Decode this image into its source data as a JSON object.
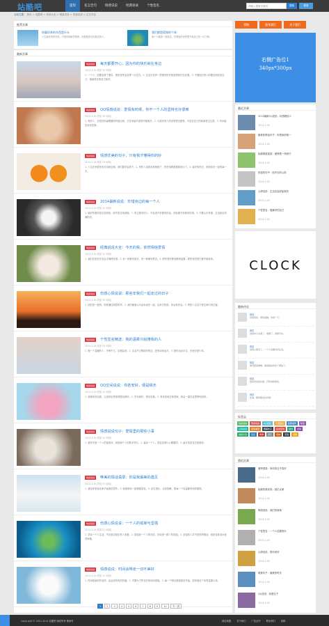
{
  "header": {
    "logo": "站酷吧",
    "nav": [
      "首页",
      "名言佳句",
      "情感说说",
      "经典语录",
      "个性签名"
    ],
    "search_placeholder": "请输入搜索关键词",
    "search_button": "搜索",
    "login_button": "登录"
  },
  "breadcrumb": {
    "home": "当前位置：",
    "path": "首页 > 站酷吧 > 说说大全 > 情感说说 > 伤感说说 > 正文内容"
  },
  "hot": {
    "title": "推荐文章",
    "items": [
      {
        "title": "你最珍贵的东西是什么",
        "desc": "人生最珍贵的东西，不是你拥有的物质，而是陪伴在你身边的人。"
      },
      {
        "title": "我们都是孤独的个体",
        "desc": "每个人都是一座孤岛，在喧嚣的世界里守着自己的一片宁静。"
      }
    ]
  },
  "list": {
    "title": "最新文章",
    "tag_label": "情感说说",
    "articles": [
      {
        "title": "每天都要开心，因为你的快乐就在身边",
        "meta": "2014-3-26  浏览 30  0评论",
        "desc": "1. 一个人，如果没有了爱情，他的世界会变得一片空白。2. 生活中总有一些美好的东西值得我们去珍惜。3. 不要因为别人的眼光而改变自己，做最真实的自己就好。"
      },
      {
        "title": "QQ情感说说：爱情有时候，你不一个人的坚持也许很难",
        "meta": "2014-3-26  浏览 28  0评论",
        "desc": "1. 有的人，总是在你最需要的时候出现，又在你最不舍的时候离开。2. 与其在别人的世界里当配角，不如在自己的故事里当主角。3. 时间会告诉你答案。"
      },
      {
        "title": "情感优美的句子，只有我才懂得你的好",
        "meta": "2014-3-26  浏览 25  0评论",
        "desc": "1. 人生总有很多的无奈和遗憾，我们要学会放下。2. 有些人走着走着就散了，有些事看着看着就淡了。3. 最好的时光，是和你在一起的每一天。"
      },
      {
        "title": "2014最新说说：珍惜身边的每一个人",
        "meta": "2014-3-26  浏览 22  0评论",
        "desc": "1. 最好的爱情是互相成就，而不是互相消耗。2. 真正爱你的人，不会说许多爱你的话，却会做许多爱你的事。3. 只要心中有爱，生活就会充满阳光。"
      },
      {
        "title": "经典说说大全：今天的我，依然相信爱情",
        "meta": "2014-3-26  浏览 20  0评论",
        "desc": "1. 我们总是在失去后才懂得珍惜。2. 有一种爱叫放手，有一种痛叫思念。3. 愿所有的等待都有结果，愿所有的努力都不被辜负。"
      },
      {
        "title": "伤感心情说说：那些年我们一起走过的日子",
        "meta": "2014-3-26  浏览 18  0评论",
        "desc": "1. 回忆是一座桥，却是通往寂寞的牢。2. 我们都曾以为会永远在一起，后来才知道，永远有多远。3. 有些人注定只是生命中的过客。"
      },
      {
        "title": "个性签名精选：我的温柔只给懂我的人",
        "meta": "2014-3-26  浏览 16  0评论",
        "desc": "1. 做一个温暖的人，不卑不亢，清澈善良。2. 生活不止眼前的苟且，还有诗和远方。3. 愿你出走半生，归来仍是少年。"
      },
      {
        "title": "QQ空间说说：你若安好，便是晴天",
        "meta": "2014-3-26  浏览 15  0评论",
        "desc": "1. 感谢你的出现，让我的世界变得更加美好。2. 岁月静好，现世安稳。3. 有你的地方就是家，我会一直在这里等你回来。"
      },
      {
        "title": "情感说说句子：爱情里的那些小事",
        "meta": "2014-3-26  浏览 14  0评论",
        "desc": "1. 爱情不是一个人的独角戏，而是两个人的携手同行。2. 喜欢一个人，是会变得小心翼翼的。3. 最长情的告白是陪伴。"
      },
      {
        "title": "唯美的情话语录：你是我最美的遇见",
        "meta": "2014-3-26  浏览 13  0评论",
        "desc": "1. 遇见你是我这辈子最美的意外。2. 我想和你一起慢慢变老。3. 余生很长，请多指教，愿每一个清晨都有你的微笑。"
      },
      {
        "title": "伤感心情说说：一个人的孤单与坚强",
        "meta": "2014-3-26  浏览 12  0评论",
        "desc": "1. 学会一个人生活，不论身边是否有人宠爱。2. 孤独是一个人的狂欢，狂欢是一群人的孤独。3. 坚强的人并不是没有眼泪，而是含着泪水依然奔跑。"
      },
      {
        "title": "情感说说：时间会带走一切不美好",
        "meta": "2014-3-26  浏览 10  0评论",
        "desc": "1. 时间是最好的良药，会治愈所有的伤痛。2. 不要为了昨天的事情而烦恼。3. 每一个明天都是新的开始，愿你被这个世界温柔以待。"
      }
    ]
  },
  "pager": [
    "1",
    "2",
    "3",
    "4",
    "5",
    "6",
    "7",
    "8",
    "9",
    "10",
    "下一页"
  ],
  "sidebar": {
    "buttons": [
      "投稿",
      "联系我们",
      "关于我们"
    ],
    "button_colors": [
      "#f06b1e",
      "#f06b1e",
      "#f06b1e"
    ],
    "ad": [
      "右侧广告位1",
      "340px*300px"
    ],
    "recent_title": "最近文章",
    "recent": [
      {
        "title": "2014最新QQ说说：珍惜眼前人",
        "date": "2014-3-26"
      },
      {
        "title": "最美的情话句子，你是我的唯一",
        "date": "2014-3-26"
      },
      {
        "title": "经典情感语录：爱情是一场修行",
        "date": "2014-3-26"
      },
      {
        "title": "伤感的句子：回不去的从前",
        "date": "2014-3-26"
      },
      {
        "title": "心情说说：生活总会好起来的",
        "date": "2014-3-26"
      },
      {
        "title": "个性签名：做最好的自己",
        "date": "2014-3-26"
      }
    ],
    "clock_text": "CLOCK",
    "comments_title": "最新评论",
    "comments": [
      {
        "name": "网友",
        "text": "写得真好，很有感触，支持一下！"
      },
      {
        "name": "网友",
        "text": "这些句子太美了，收藏了，谢谢分享。"
      },
      {
        "name": "网友",
        "text": "说到心里去了，一个人也要好好生活。"
      },
      {
        "name": "网友",
        "text": "每天都来看看，越来越喜欢这个网站了。"
      },
      {
        "name": "网友",
        "text": "很喜欢这篇文章，已转发给朋友。"
      },
      {
        "name": "网友",
        "text": "加油，期待更多好内容！"
      }
    ],
    "tags_title": "标签云",
    "tags": [
      "情感说说",
      "伤感说说",
      "QQ说说",
      "个性签名",
      "经典语录",
      "情话",
      "心情说说",
      "爱情语录",
      "唯美句子",
      "名言佳句",
      "励志",
      "友情",
      "说说大全",
      "签名",
      "青春",
      "回忆",
      "孤独",
      "坚强",
      "温暖"
    ],
    "tag_colors": [
      "#5cb85c",
      "#d9534f",
      "#5bc0de",
      "#f0ad4e",
      "#428bca",
      "#9b59b6",
      "#1abc9c",
      "#e67e22",
      "#34495e",
      "#e74c3c",
      "#16a085",
      "#8e44ad",
      "#27ae60",
      "#2980b9",
      "#c0392b",
      "#7f8c8d",
      "#d35400",
      "#2c3e50",
      "#f39c12"
    ],
    "random_title": "随机文章",
    "random": [
      {
        "title": "爱情语录：有你的日子真好",
        "date": "2014-3-26"
      },
      {
        "title": "经典伤感说说：回忆太美",
        "date": "2014-3-26"
      },
      {
        "title": "情感说说：我们的故事",
        "date": "2014-3-26"
      },
      {
        "title": "个性签名：一个人也要快乐",
        "date": "2014-3-26"
      },
      {
        "title": "心情说说：愿你安好",
        "date": "2014-3-26"
      },
      {
        "title": "唯美句子：最美的时光",
        "date": "2014-3-26"
      },
      {
        "title": "QQ说说：珍惜当下",
        "date": "2014-3-26"
      }
    ]
  },
  "footer": {
    "copyright": "Copyright © 2012-2014 站酷吧 版权所有 备案号",
    "links": [
      "网站地图",
      "关于我们",
      "广告合作",
      "联系我们",
      "投稿"
    ]
  }
}
